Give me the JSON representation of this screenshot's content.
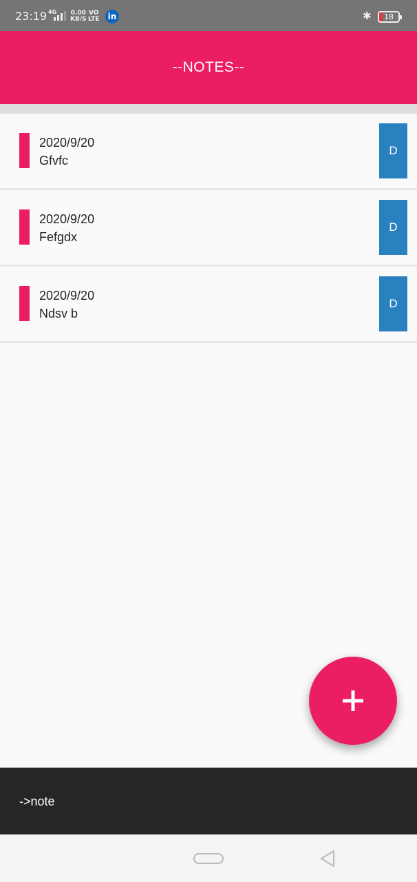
{
  "status_bar": {
    "time": "23:19",
    "network": "4G",
    "speed_value": "0.00",
    "speed_unit": "KB/S",
    "volte_top": "VO",
    "volte_bottom": "LTE",
    "linkedin_icon_text": "in",
    "battery": "18"
  },
  "app_bar": {
    "title": "--NOTES--"
  },
  "notes": [
    {
      "date": "2020/9/20",
      "title": "Gfvfc",
      "delete_label": "D"
    },
    {
      "date": "2020/9/20",
      "title": "Fefgdx",
      "delete_label": "D"
    },
    {
      "date": "2020/9/20",
      "title": "Ndsv b",
      "delete_label": "D"
    }
  ],
  "fab": {
    "icon": "plus-icon"
  },
  "snackbar": {
    "text": "->note"
  },
  "colors": {
    "accent": "#ec1e63",
    "delete_button": "#2a81c0",
    "snackbar_bg": "#262626"
  }
}
